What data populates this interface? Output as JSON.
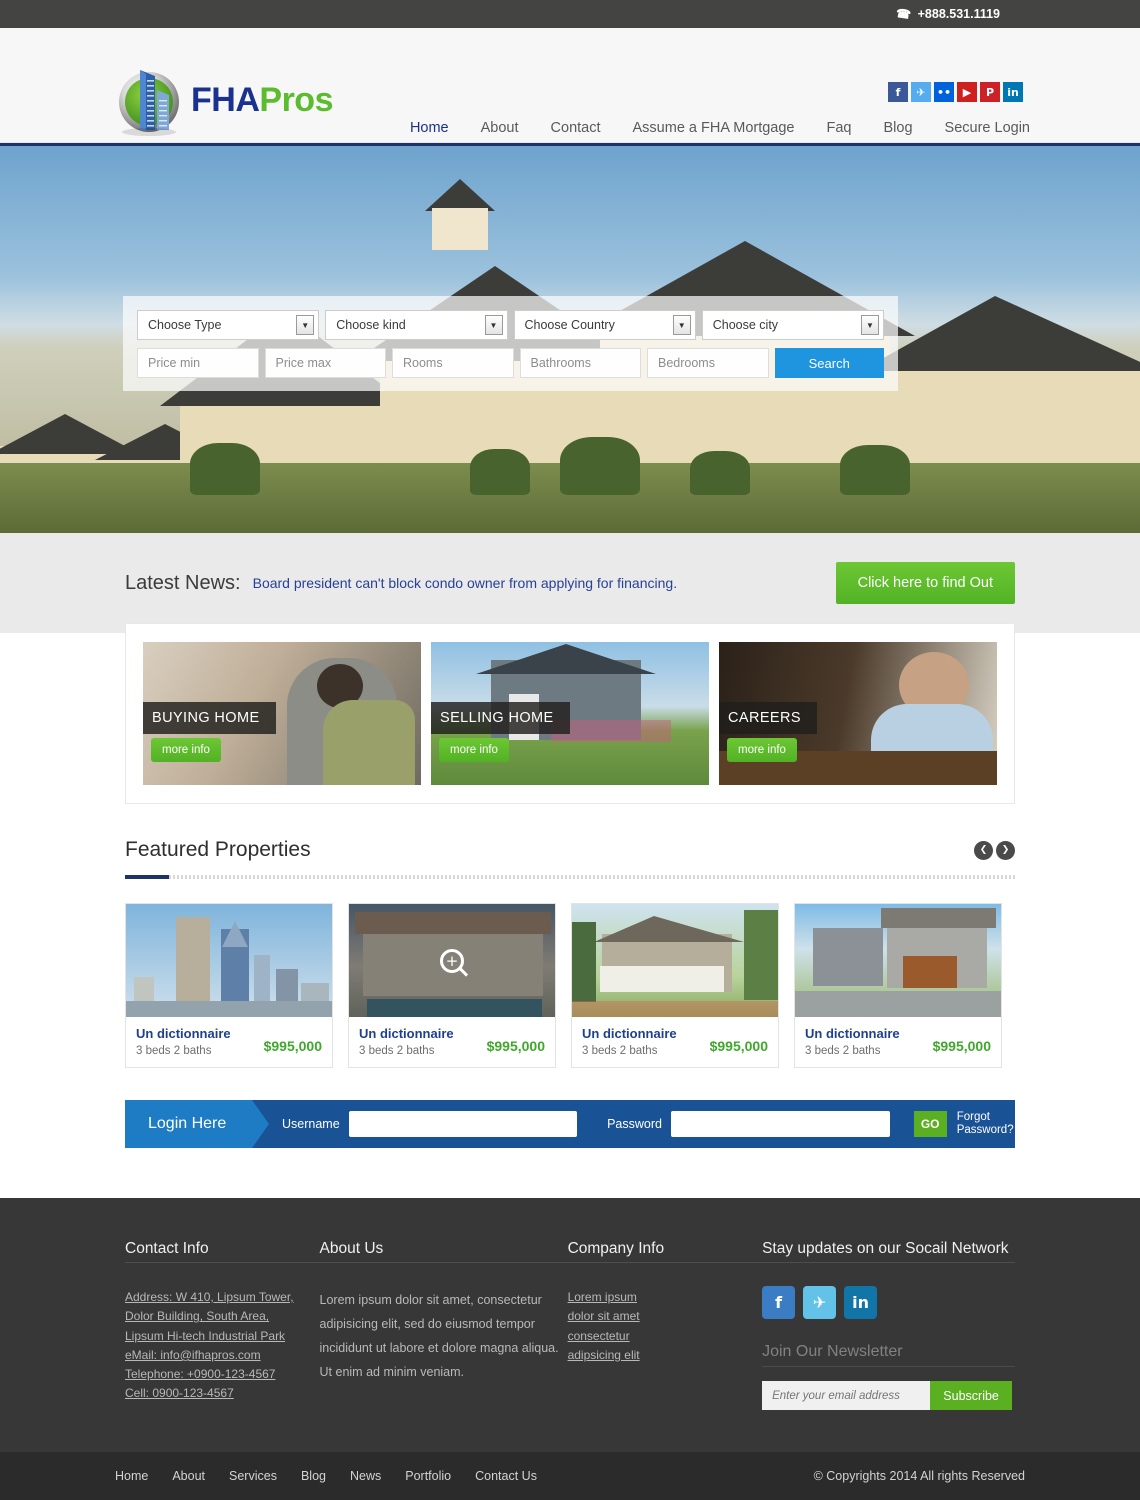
{
  "topbar": {
    "phone": "+888.531.1119",
    "phone_icon": "phone-icon"
  },
  "header": {
    "logo_primary": "FHA",
    "logo_secondary": "Pros",
    "social": [
      {
        "name": "facebook",
        "glyph": "f",
        "color": "#3b5998"
      },
      {
        "name": "twitter",
        "glyph": "✈",
        "color": "#55acee"
      },
      {
        "name": "flickr",
        "glyph": "••",
        "color": "#0063dc"
      },
      {
        "name": "youtube",
        "glyph": "▶",
        "color": "#cd201f"
      },
      {
        "name": "pinterest",
        "glyph": "P",
        "color": "#cc2127"
      },
      {
        "name": "linkedin",
        "glyph": "in",
        "color": "#0077b5"
      }
    ],
    "nav": [
      {
        "label": "Home",
        "active": true
      },
      {
        "label": "About",
        "active": false
      },
      {
        "label": "Contact",
        "active": false
      },
      {
        "label": "Assume a FHA Mortgage",
        "active": false
      },
      {
        "label": "Faq",
        "active": false
      },
      {
        "label": "Blog",
        "active": false
      },
      {
        "label": "Secure Login",
        "active": false
      }
    ]
  },
  "search": {
    "selects": [
      "Choose Type",
      "Choose kind",
      "Choose Country",
      "Choose city"
    ],
    "fields": [
      "Price min",
      "Price max",
      "Rooms",
      "Bathrooms",
      "Bedrooms"
    ],
    "button": "Search",
    "arrow_icon": "chevron-down-icon"
  },
  "news": {
    "label": "Latest News:",
    "headline": "Board president can't block condo owner from applying for financing.",
    "button": "Click here to find Out"
  },
  "promos": [
    {
      "title": "BUYING HOME",
      "button": "more info"
    },
    {
      "title": "SELLING HOME",
      "button": "more info"
    },
    {
      "title": "CAREERS",
      "button": "more info"
    }
  ],
  "featured": {
    "title": "Featured Properties",
    "prev_icon": "chevron-left-icon",
    "prev_glyph": "❮",
    "next_icon": "chevron-right-icon",
    "next_glyph": "❯",
    "properties": [
      {
        "name": "Un dictionnaire",
        "details": "3 beds 2 baths",
        "price": "$995,000",
        "hovered": false
      },
      {
        "name": "Un dictionnaire",
        "details": "3 beds 2 baths",
        "price": "$995,000",
        "hovered": true
      },
      {
        "name": "Un dictionnaire",
        "details": "3 beds 2 baths",
        "price": "$995,000",
        "hovered": false
      },
      {
        "name": "Un dictionnaire",
        "details": "3 beds 2 baths",
        "price": "$995,000",
        "hovered": false
      }
    ]
  },
  "login": {
    "tab": "Login Here",
    "username_label": "Username",
    "username_value": "",
    "password_label": "Password",
    "password_value": "",
    "go": "GO",
    "forgot": "Forgot Password?"
  },
  "footer": {
    "contact": {
      "title": "Contact Info",
      "lines": [
        "Address: W 410, Lipsum Tower,",
        "Dolor Building, South Area,",
        "Lipsum Hi-tech Industrial Park",
        "eMail: info@ifhapros.com",
        "Telephone: +0900-123-4567",
        "Cell: 0900-123-4567"
      ]
    },
    "about": {
      "title": "About Us",
      "text": "Lorem ipsum dolor sit amet, consectetur adipisicing elit, sed do eiusmod tempor incididunt ut labore et dolore magna aliqua. Ut enim ad minim veniam."
    },
    "company": {
      "title": "Company Info",
      "links": [
        "Lorem ipsum",
        "dolor sit amet",
        "consectetur",
        "adipsicing elit"
      ]
    },
    "social_block": {
      "title": "Stay updates on our Socail Network",
      "icons": [
        {
          "name": "facebook",
          "glyph": "f",
          "color": "#3b7dc4"
        },
        {
          "name": "twitter",
          "glyph": "✈",
          "color": "#62c2e8"
        },
        {
          "name": "linkedin",
          "glyph": "in",
          "color": "#1275a8"
        }
      ],
      "newsletter_title": "Join Our Newsletter",
      "email_placeholder": "Enter your email address",
      "email_value": "",
      "subscribe": "Subscribe"
    },
    "bottom_links": [
      "Home",
      "About",
      "Services",
      "Blog",
      "News",
      "Portfolio",
      "Contact Us"
    ],
    "copyright": "© Copyrights 2014 All rights Reserved"
  }
}
